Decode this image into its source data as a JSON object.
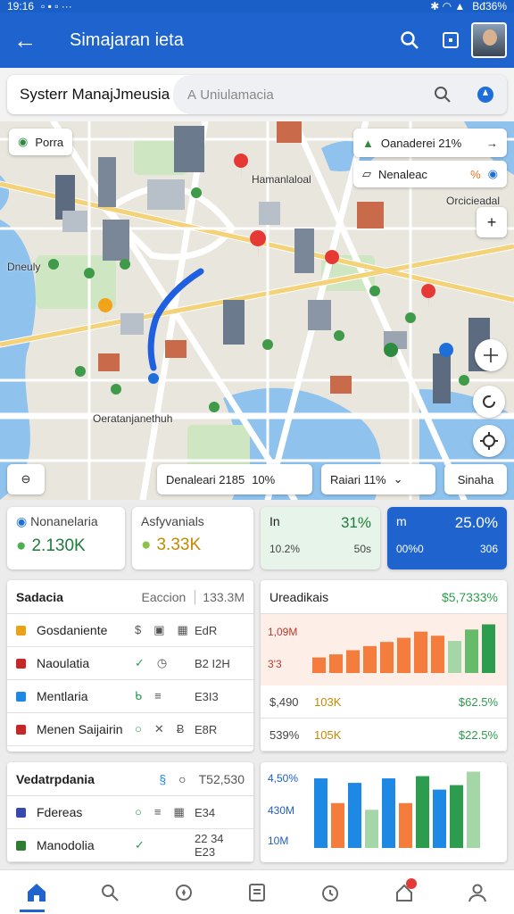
{
  "status": {
    "time": "19:16",
    "battery": "Bđ36%"
  },
  "appbar": {
    "title": "Simajaran ieta"
  },
  "search": {
    "system_label": "Systerr ManajJmeusia",
    "placeholder": "Uniulamacia"
  },
  "map": {
    "place_chip": "Porra",
    "top_chip_1": "Oanaderei 21%",
    "top_chip_2": "Nenaleac",
    "top_chip_2_val": "%",
    "place_labels": [
      "Hamanlaloal",
      "Orcicieadal",
      "Dneuly",
      "Oeratanjanethuh"
    ],
    "bottom_chip_1": "Denaleari 2185",
    "bottom_chip_1_val": "10%",
    "bottom_chip_2": "Raiari 11%",
    "bottom_chip_3": "Sinaha"
  },
  "stats": [
    {
      "title": "Nonanelaria",
      "value": "2.130K",
      "color": "#1e7d3a"
    },
    {
      "title": "Asfyvanials",
      "value": "3.33K",
      "color": "#c28a00"
    },
    {
      "title": "In",
      "value": "31%",
      "sub1": "10.2%",
      "sub2": "50s",
      "color": "#1e7d3a"
    },
    {
      "title": "m",
      "value": "25.0%",
      "sub1": "00%0",
      "sub2": "306",
      "color": "#ffffff"
    }
  ],
  "panel1": {
    "title": "Sadacia",
    "tag": "Eaccion",
    "count": "133.3M",
    "rows": [
      {
        "name": "Gosdaniente",
        "color": "#e8a317",
        "code": "EdR"
      },
      {
        "name": "Naoulatia",
        "color": "#c62828",
        "code": "B2 I2H"
      },
      {
        "name": "Mentlaria",
        "color": "#1e88e5",
        "code": "E3I3"
      },
      {
        "name": "Menen Saijairin",
        "color": "#c62828",
        "code": "E8R"
      }
    ]
  },
  "panel2": {
    "title": "Vedatrpdania",
    "code": "T52,530",
    "rows": [
      {
        "name": "Fdereas",
        "color": "#3949ab",
        "code": "E34"
      },
      {
        "name": "Manodolia",
        "color": "#2e7d32",
        "code": "22 34 E23"
      }
    ]
  },
  "chart1": {
    "title": "Ureadikais",
    "value": "$5,7333%",
    "ylabels": [
      "1,09M",
      "3'3"
    ],
    "values": [
      15,
      18,
      22,
      26,
      30,
      34,
      40,
      36,
      31,
      42,
      47
    ],
    "colors": [
      "#f47c3c",
      "#f47c3c",
      "#f47c3c",
      "#f47c3c",
      "#f47c3c",
      "#f47c3c",
      "#f47c3c",
      "#f47c3c",
      "#a5d6a7",
      "#66bb6a",
      "#2e9c4f"
    ],
    "rows": [
      {
        "left": "$,490",
        "mid": "103K",
        "right": "$62.5%"
      },
      {
        "left": "539%",
        "mid": "105K",
        "right": "$22.5%"
      }
    ]
  },
  "chart2": {
    "ylabels": [
      "4,50%",
      "430M",
      "10M"
    ],
    "values": [
      62,
      40,
      58,
      34,
      62,
      40,
      64,
      52,
      56,
      68
    ],
    "colors": [
      "#1e88e5",
      "#f47c3c",
      "#1e88e5",
      "#a5d6a7",
      "#1e88e5",
      "#f47c3c",
      "#2e9c4f",
      "#1e88e5",
      "#2e9c4f",
      "#a5d6a7"
    ]
  }
}
